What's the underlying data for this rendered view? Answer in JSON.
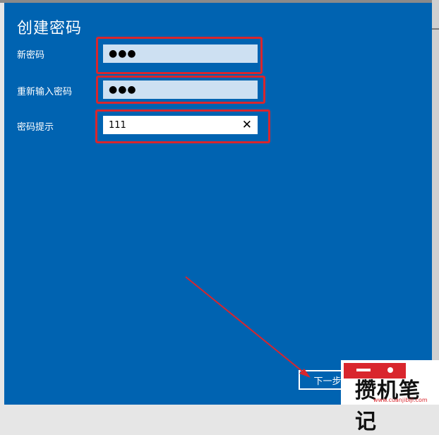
{
  "dialog": {
    "title": "创建密码",
    "fields": {
      "new_password": {
        "label": "新密码",
        "value": "●●●"
      },
      "confirm_password": {
        "label": "重新输入密码",
        "value": "●●●"
      },
      "hint": {
        "label": "密码提示",
        "value": "111",
        "clear_icon": "✕"
      }
    },
    "next_button": "下一步"
  },
  "watermark": {
    "text": "攒机笔记",
    "url": "www.cuanjibiji.com"
  },
  "colors": {
    "dialog_bg": "#0063b1",
    "highlight": "#d9262d",
    "arrow": "#d9262d"
  }
}
